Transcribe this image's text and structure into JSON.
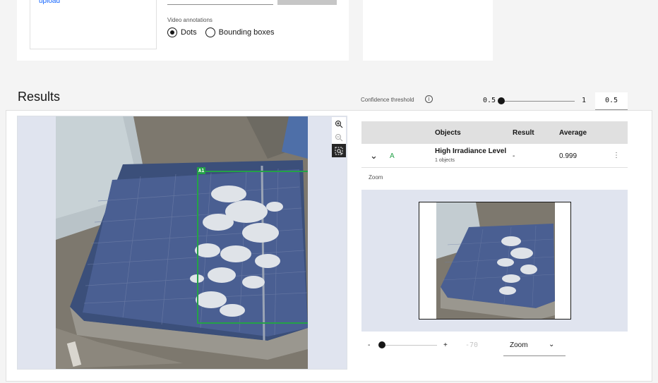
{
  "upload": {
    "link_label": "upload"
  },
  "video_annotations": {
    "label": "Video annotations",
    "options": [
      {
        "label": "Dots",
        "selected": true
      },
      {
        "label": "Bounding boxes",
        "selected": false
      }
    ]
  },
  "results": {
    "title": "Results"
  },
  "confidence": {
    "label": "Confidence threshold",
    "info_icon": "ⓘ",
    "min": "0.5",
    "max": "1",
    "value": "0.5",
    "slider_fraction": 0
  },
  "image": {
    "bbox_label": "A1",
    "bbox_color": "#24a148",
    "tools": [
      "zoom-in-icon",
      "zoom-out-icon",
      "zoom-fit-icon"
    ]
  },
  "table": {
    "headers": {
      "objects": "Objects",
      "result": "Result",
      "average": "Average"
    },
    "rows": [
      {
        "expand_icon": "⌄",
        "id": "A",
        "object": "High Irradiance Level",
        "sub": "1 objects",
        "result": "-",
        "average": "0.999",
        "menu_icon": "⋮"
      }
    ],
    "zoom_label": "Zoom"
  },
  "zoom_controls": {
    "minus": "-",
    "plus": "+",
    "value": "-70",
    "slider_fraction": 0,
    "select_label": "Zoom",
    "chevron": "⌄"
  },
  "colors": {
    "accent": "#0f62fe",
    "bbox": "#24a148",
    "background": "#f4f4f4"
  }
}
